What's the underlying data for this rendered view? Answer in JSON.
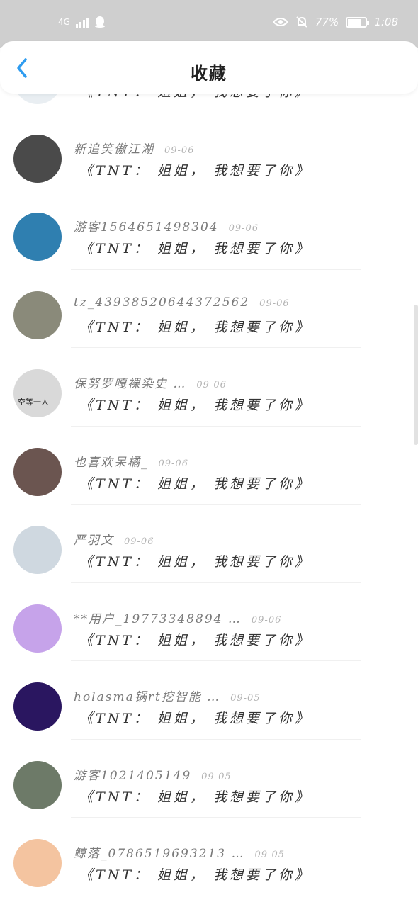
{
  "status_bar": {
    "network": "4G",
    "battery_percent": "77%",
    "battery_level": 0.77,
    "time": "1:08"
  },
  "header": {
    "title": "收藏"
  },
  "colors": {
    "accent": "#2e9cf0",
    "status_bar_bg": "#cfcfcf"
  },
  "items": [
    {
      "username": "",
      "date": "",
      "message": "《TNT： 姐姐， 我想要了你》",
      "avatar_color": "#e9eef2"
    },
    {
      "username": "新追笑傲江湖",
      "date": "09-06",
      "message": "《TNT： 姐姐， 我想要了你》",
      "avatar_color": "#4a4a4a"
    },
    {
      "username": "游客1564651498304",
      "date": "09-06",
      "message": "《TNT： 姐姐， 我想要了你》",
      "avatar_color": "#2f7fb0"
    },
    {
      "username": "tz_43938520644372562",
      "date": "09-06",
      "message": "《TNT： 姐姐， 我想要了你》",
      "avatar_color": "#8a8a7a"
    },
    {
      "username": "保努罗嘎裸染史 …",
      "date": "09-06",
      "message": "《TNT： 姐姐， 我想要了你》",
      "avatar_color": "#d9d9d9",
      "avatar_text": "空等一人"
    },
    {
      "username": "也喜欢呆橘_",
      "date": "09-06",
      "message": "《TNT： 姐姐， 我想要了你》",
      "avatar_color": "#6b5550"
    },
    {
      "username": "严羽文",
      "date": "09-06",
      "message": "《TNT： 姐姐， 我想要了你》",
      "avatar_color": "#cfd8e0"
    },
    {
      "username": "**用户_19773348894 …",
      "date": "09-06",
      "message": "《TNT： 姐姐， 我想要了你》",
      "avatar_color": "#c6a3ea"
    },
    {
      "username": "holasma锅rt挖智能 …",
      "date": "09-05",
      "message": "《TNT： 姐姐， 我想要了你》",
      "avatar_color": "#2a1660"
    },
    {
      "username": "游客1021405149",
      "date": "09-05",
      "message": "《TNT： 姐姐， 我想要了你》",
      "avatar_color": "#6d7a68"
    },
    {
      "username": "鲸落_0786519693213 …",
      "date": "09-05",
      "message": "《TNT： 姐姐， 我想要了你》",
      "avatar_color": "#f4c4a0"
    }
  ]
}
